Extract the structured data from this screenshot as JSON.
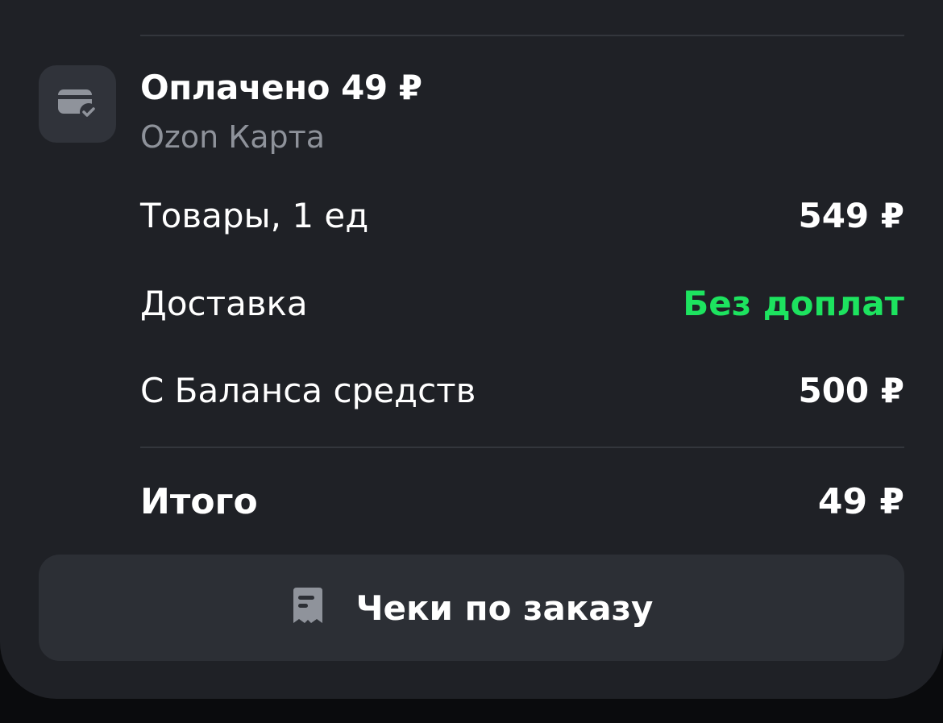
{
  "payment": {
    "title": "Оплачено 49 ₽",
    "method": "Ozon Карта",
    "icon": "credit-card-check-icon"
  },
  "summary": {
    "rows": [
      {
        "label": "Товары, 1 ед",
        "value": "549 ₽"
      },
      {
        "label": "Доставка",
        "value": "Без доплат",
        "value_color": "#1de35f"
      },
      {
        "label": "С Баланса средств",
        "value": "500 ₽"
      }
    ],
    "total": {
      "label": "Итого",
      "value": "49 ₽"
    }
  },
  "receipts_button": {
    "label": "Чеки по заказу",
    "icon": "receipt-icon"
  },
  "colors": {
    "background": "#1f2126",
    "accent_green": "#1de35f",
    "muted_text": "#8e929a"
  }
}
